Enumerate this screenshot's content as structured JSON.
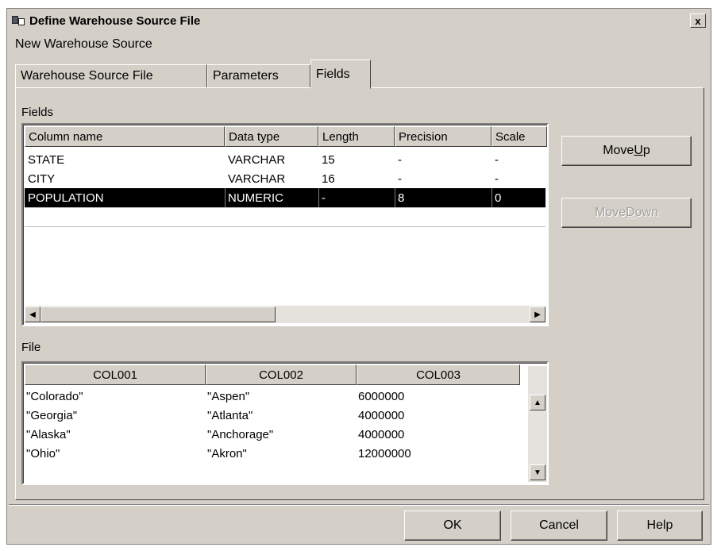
{
  "window": {
    "title": "Define Warehouse Source File",
    "subtitle": "New Warehouse Source",
    "close_label": "x"
  },
  "tabs": [
    {
      "label": "Warehouse Source File",
      "active": false
    },
    {
      "label": "Parameters",
      "active": false
    },
    {
      "label": "Fields",
      "active": true
    }
  ],
  "fields_section": {
    "label": "Fields",
    "columns": [
      "Column name",
      "Data type",
      "Length",
      "Precision",
      "Scale"
    ],
    "rows": [
      [
        "STATE",
        "VARCHAR",
        "15",
        "-",
        "-"
      ],
      [
        "CITY",
        "VARCHAR",
        "16",
        "-",
        "-"
      ],
      [
        "POPULATION",
        "NUMERIC",
        "-",
        "8",
        "0"
      ]
    ],
    "selected_row": 2
  },
  "side_buttons": {
    "move_up": {
      "prefix": "Move ",
      "accel": "U",
      "suffix": "p"
    },
    "move_down": {
      "prefix": "Move ",
      "accel": "D",
      "suffix": "own"
    }
  },
  "file_section": {
    "label": "File",
    "columns": [
      "COL001",
      "COL002",
      "COL003"
    ],
    "rows": [
      [
        "\"Colorado\"",
        "\"Aspen\"",
        "6000000"
      ],
      [
        "\"Georgia\"",
        "\"Atlanta\"",
        "4000000"
      ],
      [
        "\"Alaska\"",
        "\"Anchorage\"",
        "4000000"
      ],
      [
        "\"Ohio\"",
        "\"Akron\"",
        "12000000"
      ]
    ]
  },
  "footer": {
    "ok": "OK",
    "cancel": "Cancel",
    "help": "Help"
  },
  "colors": {
    "face": "#d4d0c8",
    "selection": "#000000"
  }
}
